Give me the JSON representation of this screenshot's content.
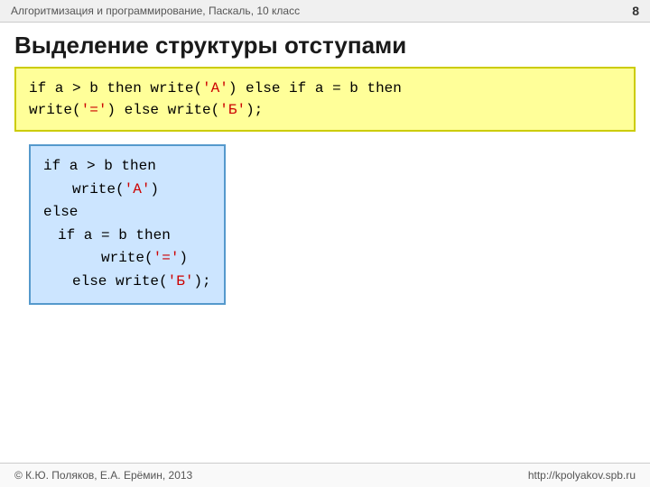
{
  "header": {
    "subtitle": "Алгоритмизация и программирование, Паскаль, 10 класс",
    "page_number": "8"
  },
  "title": "Выделение структуры отступами",
  "code_block1": {
    "line1": "if a > b then write('A') else if a = b then",
    "line2": "write('=') else write('Б');"
  },
  "code_block2": {
    "lines": [
      {
        "indent": 0,
        "text": "if a > b then"
      },
      {
        "indent": 1,
        "text": "write('A')"
      },
      {
        "indent": 0,
        "text": "else"
      },
      {
        "indent": 1,
        "text": "if a = b then"
      },
      {
        "indent": 2,
        "text": "write('=')"
      },
      {
        "indent": 1,
        "text": "else write('Б');"
      }
    ]
  },
  "footer": {
    "left": "© К.Ю. Поляков, Е.А. Ерёмин, 2013",
    "right": "http://kpolyakov.spb.ru"
  }
}
